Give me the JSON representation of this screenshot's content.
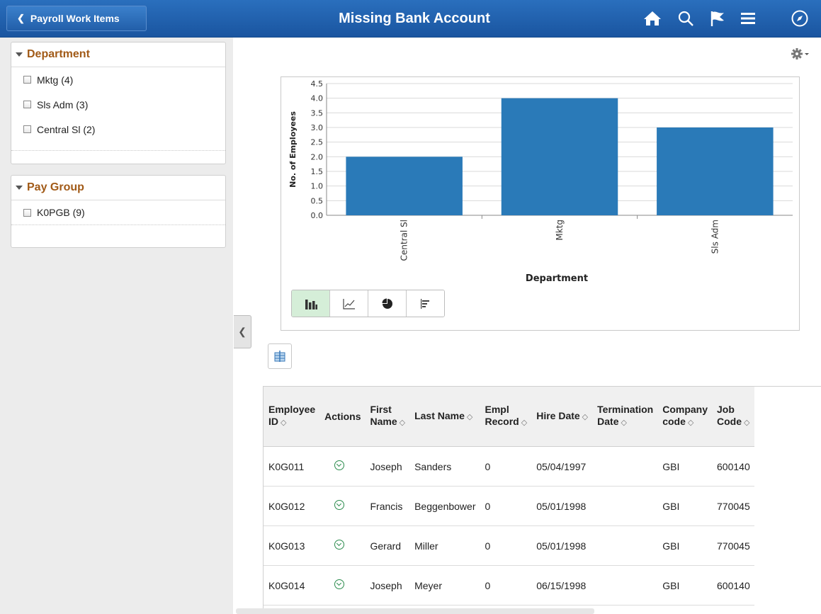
{
  "header": {
    "back_label": "Payroll Work Items",
    "title": "Missing Bank Account"
  },
  "facets": [
    {
      "title": "Department",
      "items": [
        "Mktg (4)",
        "Sls Adm (3)",
        "Central Sl (2)"
      ]
    },
    {
      "title": "Pay Group",
      "items": [
        "K0PGB (9)"
      ]
    }
  ],
  "chart_data": {
    "type": "bar",
    "categories": [
      "Central Sl",
      "Mktg",
      "Sls Adm"
    ],
    "values": [
      2.0,
      4.0,
      3.0
    ],
    "xlabel": "Department",
    "ylabel": "No. of Employees",
    "ylim": [
      0,
      4.5
    ],
    "yticks": [
      "0.0",
      "0.5",
      "1.0",
      "1.5",
      "2.0",
      "2.5",
      "3.0",
      "3.5",
      "4.0",
      "4.5"
    ],
    "grid": true,
    "bar_color": "#2a7ab8"
  },
  "chart_types": [
    "bar-chart-icon",
    "line-chart-icon",
    "pie-chart-icon",
    "horizontal-bar-chart-icon"
  ],
  "table": {
    "columns": [
      {
        "label1": "Employee",
        "label2": "ID"
      },
      {
        "label1": "Actions",
        "label2": ""
      },
      {
        "label1": "First",
        "label2": "Name"
      },
      {
        "label1": "Last Name",
        "label2": ""
      },
      {
        "label1": "Empl",
        "label2": "Record"
      },
      {
        "label1": "Hire Date",
        "label2": ""
      },
      {
        "label1": "Termination",
        "label2": "Date"
      },
      {
        "label1": "Company",
        "label2": "code"
      },
      {
        "label1": "Job",
        "label2": "Code"
      }
    ],
    "rows": [
      [
        "K0G011",
        "",
        "Joseph",
        "Sanders",
        "0",
        "05/04/1997",
        "",
        "GBI",
        "600140"
      ],
      [
        "K0G012",
        "",
        "Francis",
        "Beggenbower",
        "0",
        "05/01/1998",
        "",
        "GBI",
        "770045"
      ],
      [
        "K0G013",
        "",
        "Gerard",
        "Miller",
        "0",
        "05/01/1998",
        "",
        "GBI",
        "770045"
      ],
      [
        "K0G014",
        "",
        "Joseph",
        "Meyer",
        "0",
        "06/15/1998",
        "",
        "GBI",
        "600140"
      ]
    ]
  }
}
